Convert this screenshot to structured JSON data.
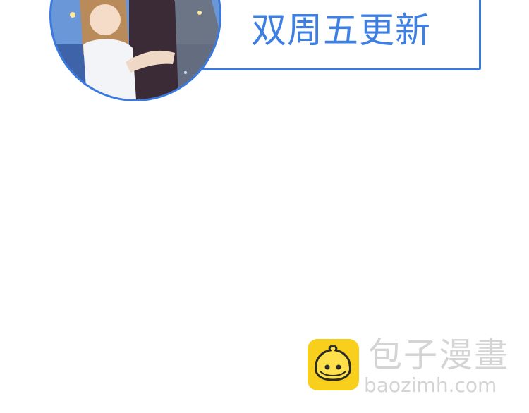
{
  "banner": {
    "schedule_text": "双周五更新"
  },
  "cover": {
    "image_name": "cover-illustration"
  },
  "watermark": {
    "logo_icon": "bun-mascot-icon",
    "title": "包子漫畫",
    "url": "baozimh.com"
  },
  "colors": {
    "accent": "#3a7ae0",
    "banner_text": "#3d7fe2",
    "logo_yellow": "#f7cf1c",
    "watermark_gray": "#d4d4d4"
  }
}
